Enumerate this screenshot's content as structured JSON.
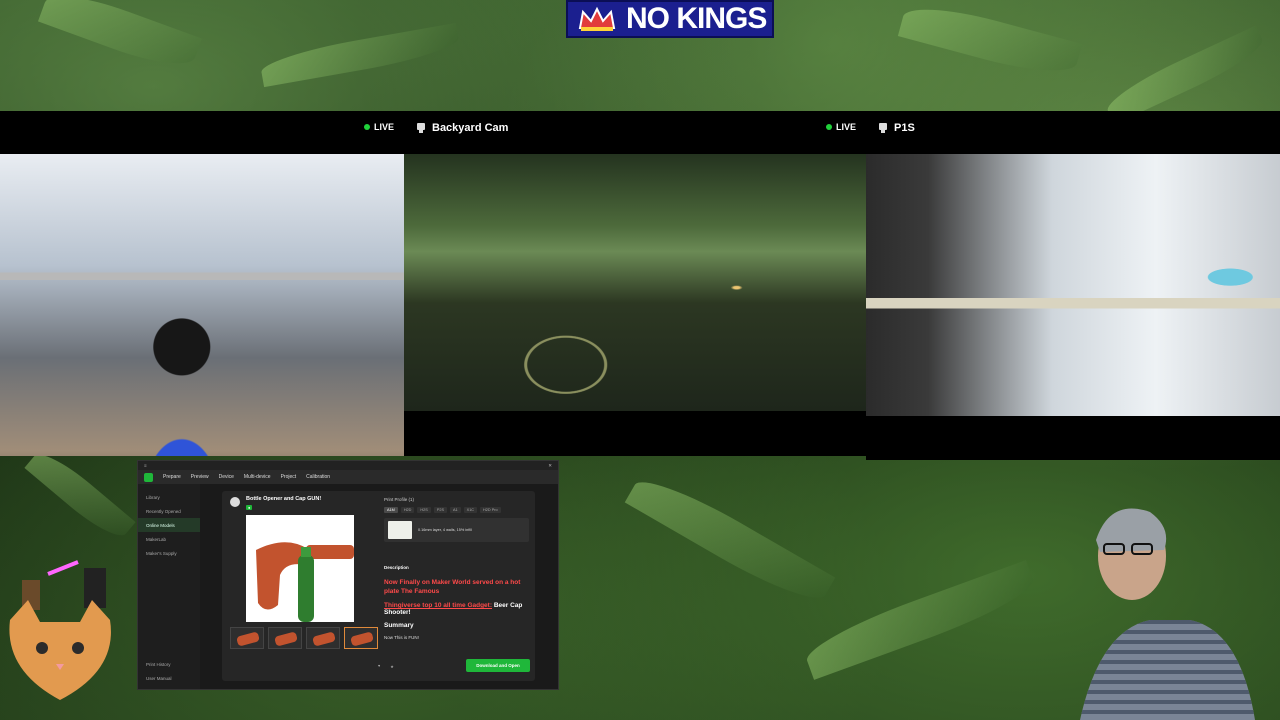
{
  "banner": {
    "text": "NO KINGS"
  },
  "cameras": {
    "cam1": {
      "title": "",
      "status": "LIVE"
    },
    "cam2": {
      "title": "Backyard Cam",
      "status": "LIVE"
    },
    "cam3": {
      "title": "P1S"
    }
  },
  "app": {
    "nav": [
      "Prepare",
      "Preview",
      "Device",
      "Multi-device",
      "Project",
      "Calibration"
    ],
    "sidebar": {
      "items": [
        "Library",
        "Recently Opened",
        "Online Models",
        "MakerLab",
        "Maker's Supply"
      ],
      "bottom": [
        "Print History",
        "User Manual"
      ]
    },
    "modal": {
      "title": "Bottle Opener and Cap GUN!",
      "print_profiles_label": "Print Profile (1)",
      "printers": [
        "A1M",
        "H2D",
        "H2S",
        "P2S",
        "A1",
        "X1C",
        "H2D Pro"
      ],
      "profile_line": "0.16mm layer, 4 walls, 15% infill",
      "description_label": "Description",
      "desc_line1": "Now Finally on Maker World served on a hot plate The Famous",
      "desc_red": "Thingiverse top 10 all time Gadget:",
      "desc_black": "Beer Cap Shooter!",
      "summary": "Summary",
      "fun": "Now This is FUN!",
      "download_button": "Download and Open"
    }
  },
  "colors": {
    "accent_green": "#1fb73a",
    "desc_red": "#ff4a4a",
    "banner_blue": "#1b1f8f"
  },
  "icons": [
    "crown-icon",
    "camera-icon",
    "live-dot-icon"
  ]
}
